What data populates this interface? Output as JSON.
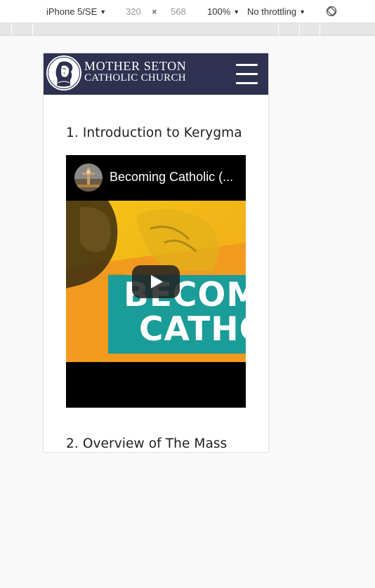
{
  "devtools": {
    "device": "iPhone 5/SE",
    "width": "320",
    "separator": "×",
    "height": "568",
    "zoom": "100%",
    "throttling": "No throttling",
    "dropdown_caret": "▼",
    "rotate_icon": "rotate-icon"
  },
  "site": {
    "logo_line1": "MOTHER SETON",
    "logo_line2": "CATHOLIC CHURCH",
    "menu_icon": "hamburger-menu-icon"
  },
  "sections": [
    {
      "title": "1. Introduction to Kerygma",
      "video": {
        "title": "Becoming Catholic (...",
        "thumb_line1": "BECOM",
        "thumb_line2": "CATHO",
        "play_icon": "play-icon"
      }
    },
    {
      "title": "2. Overview of The Mass"
    }
  ],
  "colors": {
    "header_bg": "#2e3150",
    "thumb_yellow": "#f6c516",
    "thumb_orange": "#f29a1f",
    "thumb_teal": "#1a9c98",
    "play_bg": "#212121"
  }
}
